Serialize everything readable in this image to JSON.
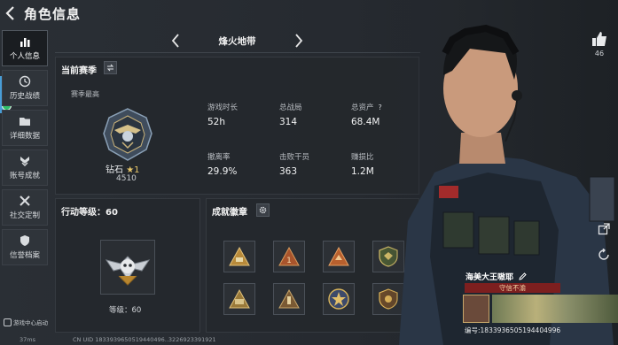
{
  "header": {
    "title": "角色信息"
  },
  "sidebar": {
    "items": [
      {
        "label": "个人信息",
        "active": true,
        "icon": "bar-chart-icon"
      },
      {
        "label": "历史战绩",
        "active": false,
        "icon": "history-icon"
      },
      {
        "label": "详细数据",
        "active": false,
        "icon": "folder-icon"
      },
      {
        "label": "账号成就",
        "active": false,
        "icon": "medal-icon"
      },
      {
        "label": "社交定制",
        "active": false,
        "icon": "tools-icon"
      },
      {
        "label": "信誉档案",
        "active": false,
        "icon": "shield-icon"
      }
    ],
    "mini_label": "游戏中心启动"
  },
  "season": {
    "name": "烽火地带",
    "current_label": "当前赛季",
    "peak_label": "赛季最高",
    "rank_name": "钻石",
    "rank_star": "★1",
    "rank_score": "4510",
    "stats": [
      {
        "key": "游戏时长",
        "value": "52h"
      },
      {
        "key": "总战局",
        "value": "314"
      },
      {
        "key": "总资产",
        "value": "68.4M",
        "help": "?"
      },
      {
        "key": "撤离率",
        "value": "29.9%"
      },
      {
        "key": "击败干员",
        "value": "363"
      },
      {
        "key": "赚损比",
        "value": "1.2M"
      }
    ]
  },
  "level": {
    "title": "行动等级：60",
    "caption": "等级：60"
  },
  "badges": {
    "title": "成就徽章",
    "items": [
      "badge-triangle-gold",
      "badge-triangle-red",
      "badge-triangle-orange",
      "badge-shield-green",
      "badge-triangle-gold-2",
      "badge-triangle-brown",
      "badge-star-gold",
      "badge-shield-gold"
    ]
  },
  "character": {
    "like_count": "46",
    "player_name": "海美大王嗷耶",
    "player_title": "守信不渝",
    "player_id": "编号:1833936505194404996"
  },
  "footer": {
    "uid": "CN UID 1833939650519440496..3226923391921",
    "stat": "37ms"
  },
  "colors": {
    "accent": "#7d1f1f",
    "panel": "#24282d",
    "text": "#e6e8ea"
  }
}
